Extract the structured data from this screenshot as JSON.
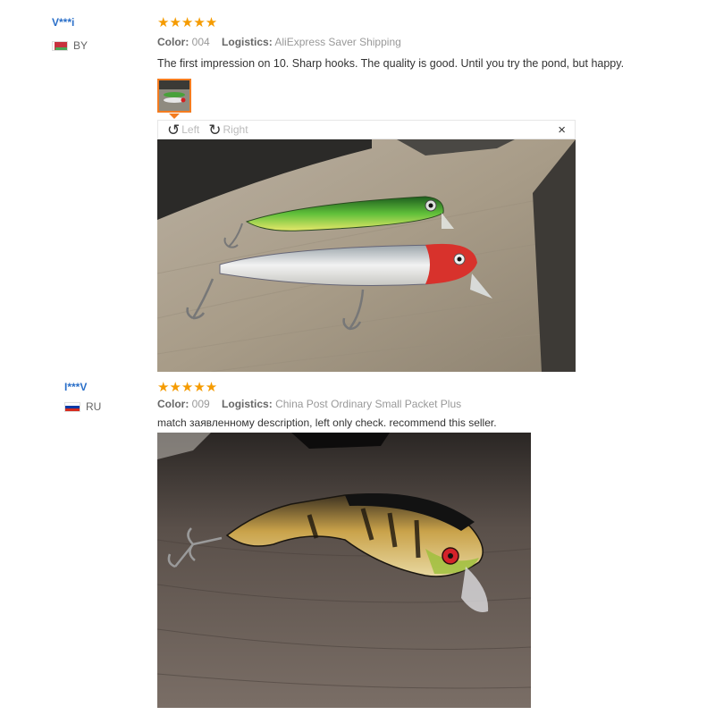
{
  "reviews": [
    {
      "user": "V***i",
      "country": "BY",
      "stars": "★★★★★",
      "color_label": "Color:",
      "color_value": "004",
      "logistics_label": "Logistics:",
      "logistics_value": "AliExpress Saver Shipping",
      "text": "The first impression on 10. Sharp hooks. The quality is good. Until you try the pond, but happy."
    },
    {
      "user": "I***V",
      "country": "RU",
      "stars": "★★★★★",
      "color_label": "Color:",
      "color_value": "009",
      "logistics_label": "Logistics:",
      "logistics_value": "China Post Ordinary Small Packet Plus",
      "text": "match заявленному description, left only check. recommend this seller."
    }
  ],
  "viewer": {
    "rotate_left": "Left",
    "rotate_right": "Right",
    "close": "×"
  },
  "icons": {
    "rotate_left": "rotate-left-icon",
    "rotate_right": "rotate-right-icon",
    "close": "close-icon",
    "star": "star-icon"
  },
  "colors": {
    "username": "#2a6fc9",
    "stars": "#f59b00",
    "thumb_border": "#f47c20"
  }
}
